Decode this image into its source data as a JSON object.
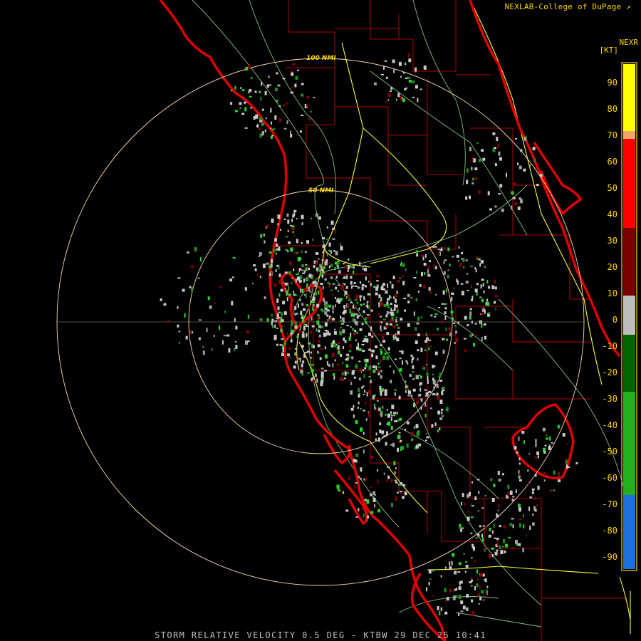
{
  "header": {
    "credit": "NEXLAB-College of DuPage",
    "credit_icon": "external-link-icon",
    "product": "NEXR",
    "units": "[KT]"
  },
  "footer": {
    "title": "STORM RELATIVE VELOCITY 0.5 DEG - KTBW 29 DEC 25 10:41"
  },
  "range_rings": [
    {
      "label": "50 NMI"
    },
    {
      "label": "100 NMI"
    }
  ],
  "colorbar": {
    "ticks": [
      "90",
      "80",
      "70",
      "60",
      "50",
      "40",
      "30",
      "20",
      "10",
      "0",
      "-10",
      "-20",
      "-30",
      "-40",
      "-50",
      "-60",
      "-70",
      "-80",
      "-90"
    ],
    "colors": {
      "inbound_strong": "#ffff00",
      "inbound": "#ff1a1a",
      "inbound_weak": "#7a0000",
      "near_zero": "#bdbdbd",
      "outbound_weak": "#006400",
      "outbound": "#22cc22",
      "outbound_strong": "#1e90ff"
    }
  },
  "map_colors": {
    "coastline": "#e00000",
    "county_lines": "#b00000",
    "highways": "#ffff33",
    "roads": "#88cc88",
    "range_rings": "#ffd9a8"
  }
}
